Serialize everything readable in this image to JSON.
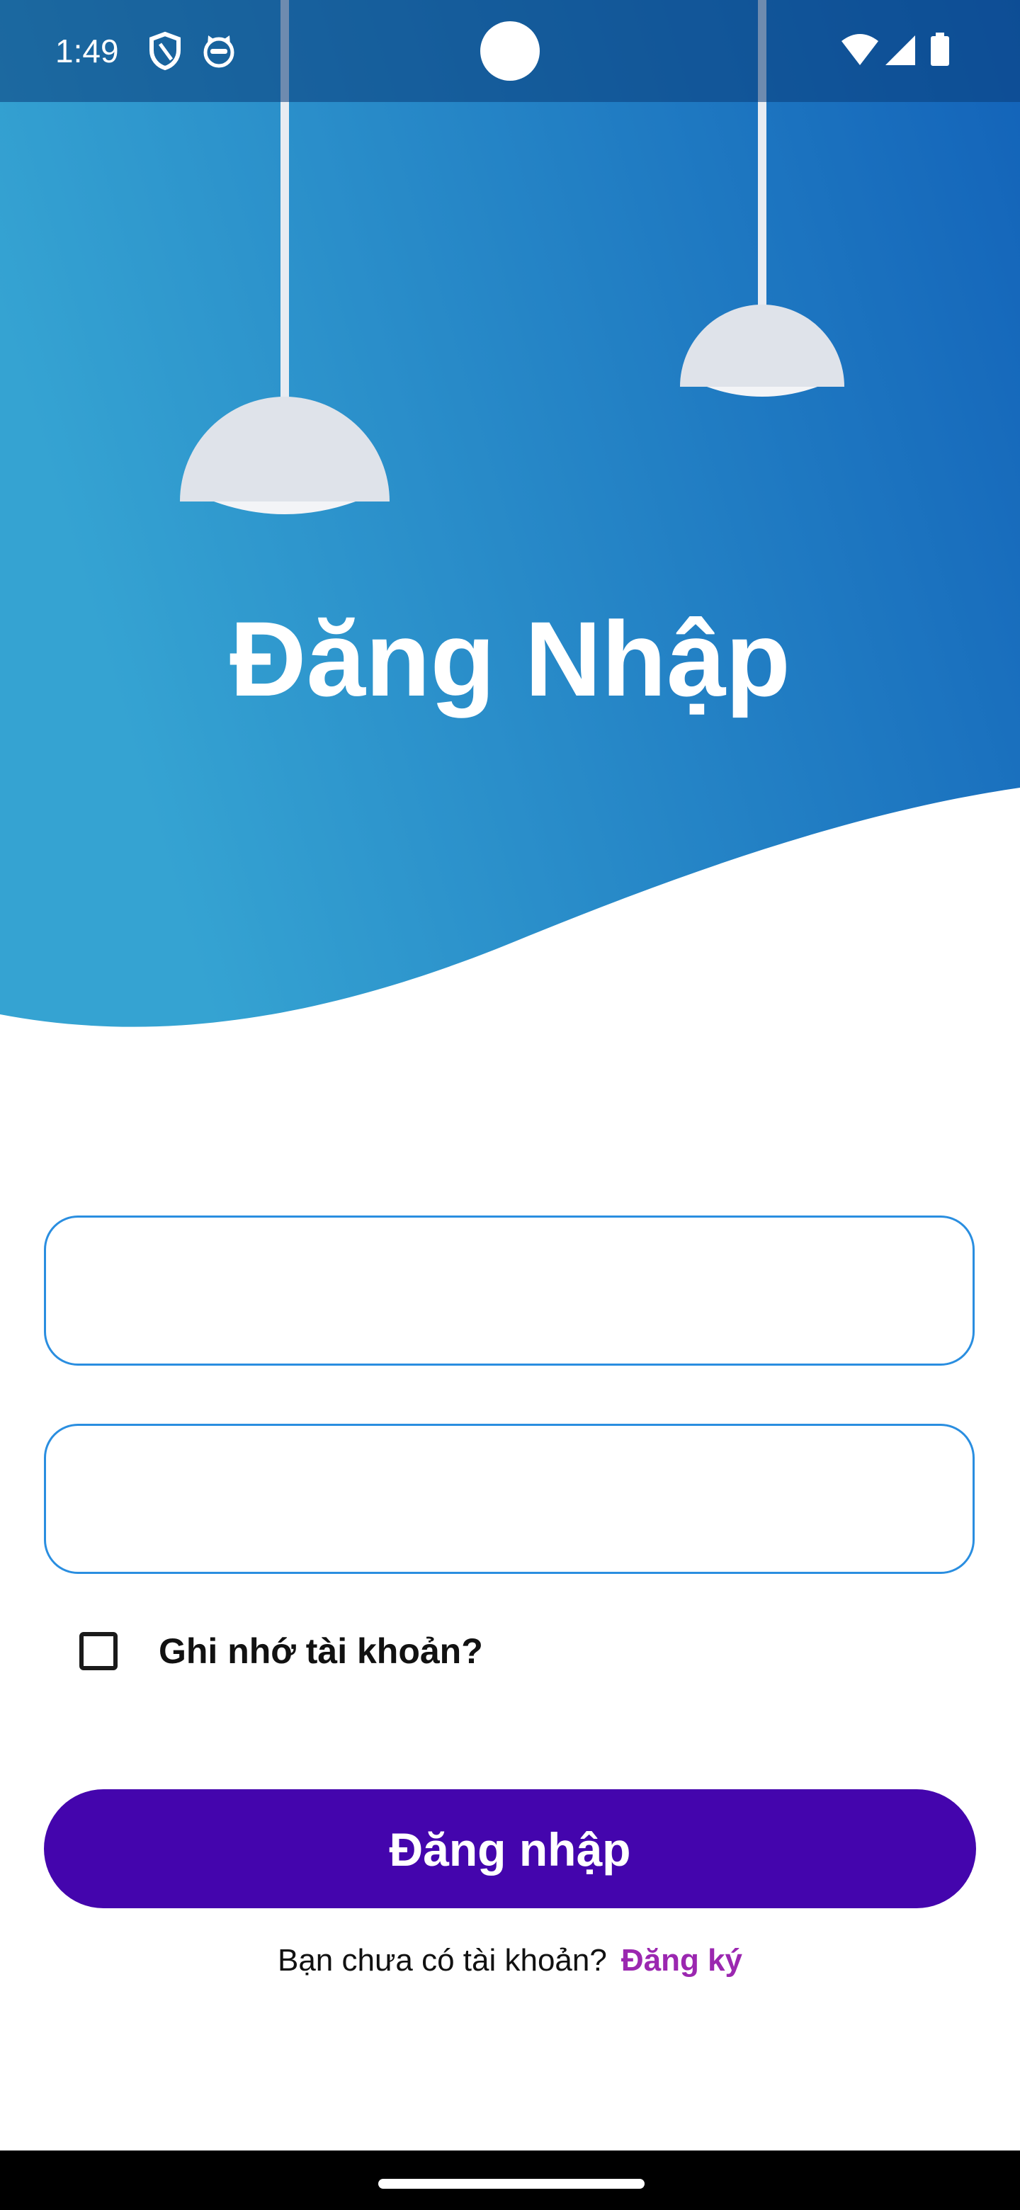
{
  "status_bar": {
    "time": "1:49",
    "icons": [
      "shield-icon",
      "cat-icon",
      "wifi-icon",
      "signal-icon",
      "battery-icon"
    ]
  },
  "header": {
    "title": "Đăng Nhập",
    "gradient_colors": [
      "#35a3d2",
      "#1363b9"
    ]
  },
  "form": {
    "username_value": "",
    "password_value": "",
    "remember_label": "Ghi nhớ tài khoản?",
    "remember_checked": false,
    "login_button_label": "Đăng nhập"
  },
  "footer": {
    "prompt_text": "Bạn chưa có tài khoản?",
    "signup_link_label": "Đăng ký"
  },
  "colors": {
    "field_border": "#2a8ee0",
    "button_bg": "#4405ad",
    "link": "#9b27b0"
  }
}
